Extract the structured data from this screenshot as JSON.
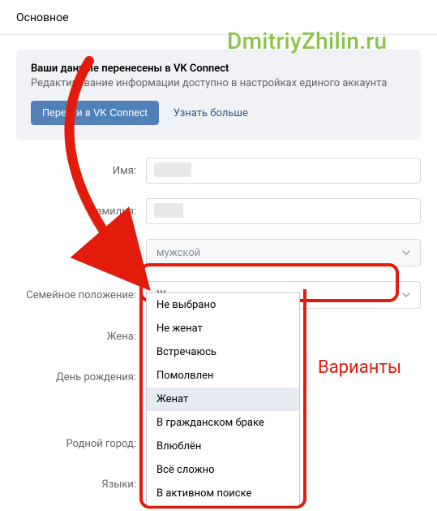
{
  "page": {
    "title": "Основное"
  },
  "watermark": "DmitriyZhilin.ru",
  "notice": {
    "title": "Ваши данные перенесены в VK Connect",
    "subtitle": "Редактирование информации доступно в настройках единого аккаунта",
    "primary_btn": "Перейти в VK Connect",
    "link": "Узнать больше"
  },
  "form": {
    "name_label": "Имя:",
    "surname_label": "амилия:",
    "gender_label": "",
    "gender_value": "мужской",
    "marital_label": "Семейное положение:",
    "marital_value": "Женат",
    "wife_label": "Жена:",
    "birthday_label": "День рождения:",
    "hometown_label": "Родной город:",
    "languages_label": "Языки:"
  },
  "marital_options": [
    "Не выбрано",
    "Не женат",
    "Встречаюсь",
    "Помолвлен",
    "Женат",
    "В гражданском браке",
    "Влюблён",
    "Всё сложно",
    "В активном поиске"
  ],
  "annotation": "Варианты"
}
